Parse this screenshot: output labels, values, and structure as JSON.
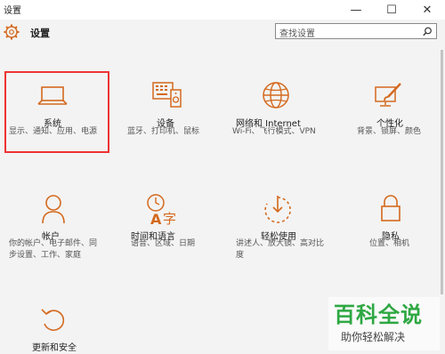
{
  "window": {
    "title": "设置",
    "minimize": "—",
    "maximize": "☐",
    "close": "✕"
  },
  "header": {
    "title": "设置",
    "search_placeholder": "查找设置"
  },
  "accent_color": "#d4691e",
  "tiles": [
    {
      "label": "系统",
      "desc": "显示、通知、应用、电源",
      "icon": "laptop-icon"
    },
    {
      "label": "设备",
      "desc": "蓝牙、打印机、鼠标",
      "icon": "devices-icon"
    },
    {
      "label": "网络和 Internet",
      "desc": "Wi-Fi、飞行模式、VPN",
      "icon": "globe-icon"
    },
    {
      "label": "个性化",
      "desc": "背景、锁屏、颜色",
      "icon": "personalize-icon"
    },
    {
      "label": "帐户",
      "desc": "你的帐户、电子邮件、同步设置、工作、家庭",
      "icon": "person-icon"
    },
    {
      "label": "时间和语言",
      "desc": "语音、区域、日期",
      "icon": "time-language-icon"
    },
    {
      "label": "轻松使用",
      "desc": "讲述人、放大镜、高对比度",
      "icon": "ease-of-access-icon"
    },
    {
      "label": "隐私",
      "desc": "位置、相机",
      "icon": "lock-icon"
    },
    {
      "label": "更新和安全",
      "desc": "",
      "icon": "refresh-icon"
    }
  ],
  "watermark": {
    "big": "百科全说",
    "small": "助你轻松解决"
  }
}
